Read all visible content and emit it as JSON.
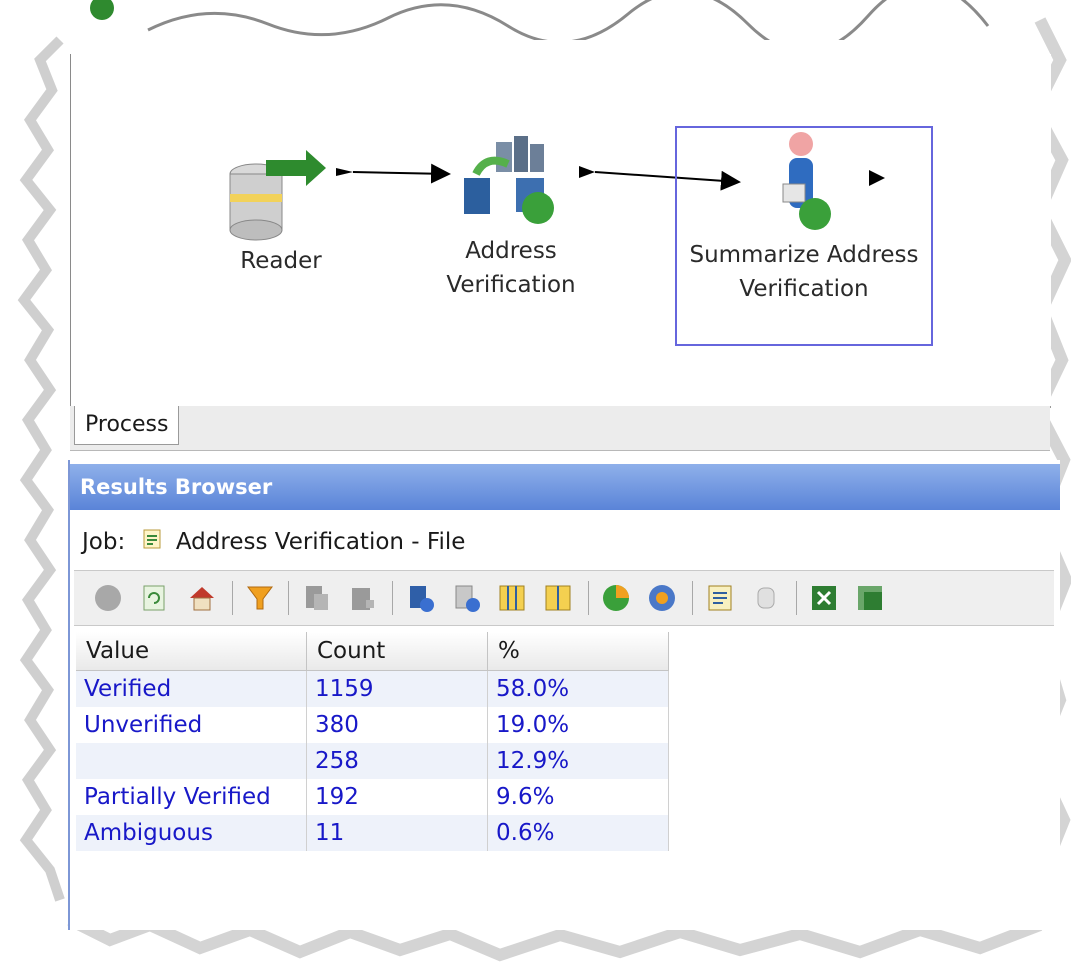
{
  "canvas": {
    "nodes": [
      {
        "label": "Reader"
      },
      {
        "label": "Address Verification"
      },
      {
        "label": "Summarize Address Verification"
      }
    ]
  },
  "tabs": {
    "process_label": "Process"
  },
  "results_browser": {
    "title": "Results Browser",
    "job_label": "Job:",
    "job_name": "Address Verification - File",
    "toolbar_icons": [
      "back-icon",
      "refresh-icon",
      "home-icon",
      "filter-icon",
      "copy-icon",
      "paste-icon",
      "database-info-icon",
      "database-link-icon",
      "columns-icon",
      "columns-alt-icon",
      "pie-chart-icon",
      "globe-icon",
      "report-icon",
      "cylinder-icon",
      "excel-icon",
      "excel-alt-icon"
    ],
    "table": {
      "columns": [
        "Value",
        "Count",
        "%"
      ],
      "rows": [
        {
          "value": "Verified",
          "count": "1159",
          "pct": "58.0%"
        },
        {
          "value": "Unverified",
          "count": "380",
          "pct": "19.0%"
        },
        {
          "value": "",
          "count": "258",
          "pct": "12.9%"
        },
        {
          "value": "Partially Verified",
          "count": "192",
          "pct": "9.6%"
        },
        {
          "value": "Ambiguous",
          "count": "11",
          "pct": "0.6%"
        }
      ]
    }
  },
  "colors": {
    "header_gradient_top": "#8fb0ea",
    "header_gradient_bottom": "#5a84d8",
    "selected_node_border": "#6666dd",
    "table_text": "#1818c8"
  }
}
